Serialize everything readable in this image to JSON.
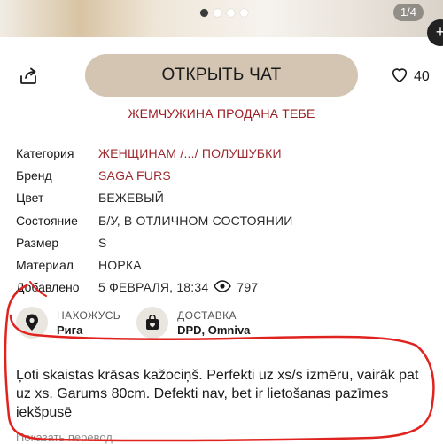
{
  "photo": {
    "counter": "1/4",
    "dots": [
      true,
      false,
      false,
      false
    ]
  },
  "actions": {
    "chat_label": "ОТКРЫТЬ ЧАТ",
    "favorites_count": "40"
  },
  "sold_banner": "ЖЕМЧУЖИНА ПРОДАНА ТЕБЕ",
  "specs": [
    {
      "key": "Категория",
      "value": "ЖЕНЩИНАМ /.../ ПОЛУШУБКИ",
      "link": true
    },
    {
      "key": "Бренд",
      "value": "SAGA FURS",
      "link": true
    },
    {
      "key": "Цвет",
      "value": "БЕЖЕВЫЙ",
      "link": false
    },
    {
      "key": "Состояние",
      "value": "Б/У, В ОТЛИЧНОМ СОСТОЯНИИ",
      "link": false
    },
    {
      "key": "Размер",
      "value": "S",
      "link": false
    },
    {
      "key": "Материал",
      "value": "НОРКА",
      "link": false
    }
  ],
  "added": {
    "key": "Добавлено",
    "date": "5 ФЕВРАЛЯ, 18:34",
    "views": "797"
  },
  "location": {
    "label": "НАХОЖУСЬ",
    "value": "Рига"
  },
  "delivery": {
    "label": "ДОСТАВКА",
    "value": "DPD, Omniva"
  },
  "description": "Ļoti skaistas krāsas kažociņš. Perfekti uz xs/s izmēru, vairāk pat uz xs. Garums 80cm. Defekti nav, bet ir lietošanas pazīmes iekšpusē",
  "translate_label": "Показать перевод",
  "colors": {
    "accent": "#9b1c22",
    "chat_button": "#d3c5b2",
    "annotation": "#e0231f"
  }
}
